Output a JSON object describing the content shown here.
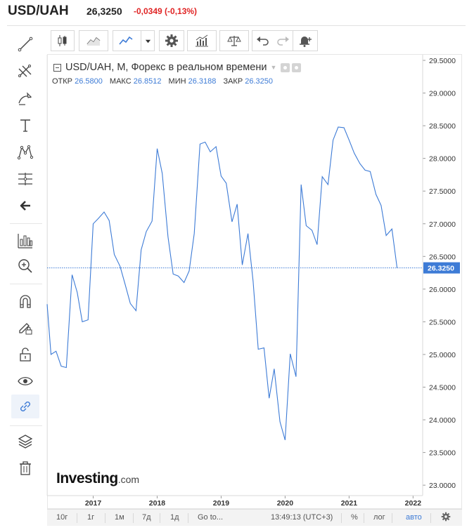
{
  "header": {
    "pair": "USD/UAH",
    "price": "26,3250",
    "change": "-0,0349 (-0,13%)"
  },
  "chart_legend": {
    "title": "USD/UAH, M, Форекс в реальном времени",
    "open_label": "ОТКР",
    "open_value": "26.5800",
    "high_label": "МАКС",
    "high_value": "26.8512",
    "low_label": "МИН",
    "low_value": "26.3188",
    "close_label": "ЗАКР",
    "close_value": "26.3250"
  },
  "logo": {
    "main": "Investing",
    "suffix": ".com"
  },
  "bottom_bar": {
    "ranges": [
      "10г",
      "1г",
      "1м",
      "7д",
      "1д"
    ],
    "goto": "Go to...",
    "time": "13:49:13 (UTC+3)",
    "percent": "%",
    "log": "лог",
    "auto": "авто"
  },
  "sidebar_icons": [
    "trend-line-icon",
    "fib-icon",
    "brush-icon",
    "text-icon",
    "pattern-icon",
    "measure-icon",
    "back-arrow-icon",
    "indicator-icon",
    "zoom-icon",
    "magnet-icon",
    "lock-drawing-icon",
    "unlock-icon",
    "eye-icon",
    "link-icon",
    "layers-icon",
    "trash-icon"
  ],
  "colors": {
    "line": "#3d7bd6",
    "price_label": "#3d7bd6",
    "change": "#e02424"
  },
  "chart_data": {
    "type": "line",
    "x_ticks": [
      "2017",
      "2018",
      "2019",
      "2020",
      "2021",
      "2022"
    ],
    "y_ticks": [
      "29.5000",
      "29.0000",
      "28.5000",
      "28.0000",
      "27.5000",
      "27.0000",
      "26.5000",
      "26.0000",
      "25.5000",
      "25.0000",
      "24.5000",
      "24.0000",
      "23.5000",
      "23.0000"
    ],
    "ylim": [
      22.9,
      29.55
    ],
    "xlim": [
      2016.28,
      2022.15
    ],
    "last_price_label": "26.3250",
    "last_price": 26.325,
    "x": [
      2016.28,
      2016.34,
      2016.42,
      2016.5,
      2016.58,
      2016.67,
      2016.75,
      2016.83,
      2016.92,
      2017.0,
      2017.08,
      2017.17,
      2017.25,
      2017.33,
      2017.42,
      2017.5,
      2017.58,
      2017.67,
      2017.75,
      2017.83,
      2017.92,
      2018.0,
      2018.08,
      2018.17,
      2018.25,
      2018.33,
      2018.42,
      2018.5,
      2018.58,
      2018.67,
      2018.75,
      2018.83,
      2018.92,
      2019.0,
      2019.08,
      2019.17,
      2019.25,
      2019.33,
      2019.42,
      2019.5,
      2019.58,
      2019.67,
      2019.75,
      2019.83,
      2019.92,
      2020.0,
      2020.08,
      2020.17,
      2020.25,
      2020.33,
      2020.42,
      2020.5,
      2020.58,
      2020.67,
      2020.75,
      2020.83,
      2020.92,
      2021.0,
      2021.08,
      2021.17,
      2021.25,
      2021.33,
      2021.42,
      2021.5,
      2021.58,
      2021.67,
      2021.75
    ],
    "values": [
      25.77,
      25.0,
      25.05,
      24.82,
      24.8,
      26.22,
      25.95,
      25.5,
      25.53,
      27.0,
      27.08,
      27.18,
      27.05,
      26.53,
      26.35,
      26.07,
      25.78,
      25.67,
      26.6,
      26.88,
      27.04,
      28.15,
      27.77,
      26.8,
      26.23,
      26.2,
      26.1,
      26.28,
      26.85,
      28.22,
      28.25,
      28.1,
      28.18,
      27.73,
      27.62,
      27.03,
      27.3,
      26.37,
      26.85,
      26.12,
      25.08,
      25.1,
      24.33,
      24.78,
      23.97,
      23.69,
      25.01,
      24.66,
      27.6,
      26.97,
      26.9,
      26.68,
      27.72,
      27.6,
      28.28,
      28.48,
      28.47,
      28.28,
      28.08,
      27.92,
      27.82,
      27.8,
      27.45,
      27.28,
      26.82,
      26.92,
      26.325
    ]
  }
}
